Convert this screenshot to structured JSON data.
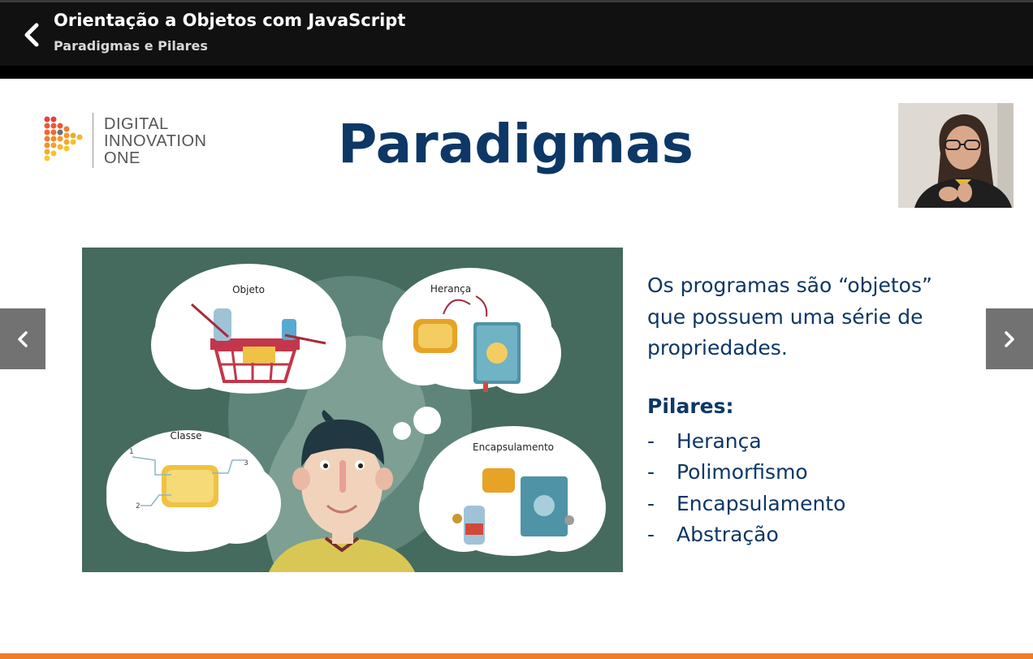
{
  "header": {
    "back_icon": "chevron-left-icon",
    "course_title": "Orientação a Objetos com JavaScript",
    "lesson_title": "Paradigmas e Pilares"
  },
  "slide": {
    "logo": {
      "line1": "DIGITAL",
      "line2": "INNOVATION",
      "line3": "ONE"
    },
    "title": "Paradigmas",
    "illustration_labels": {
      "objeto": "Objeto",
      "heranca": "Herança",
      "classe": "Classe",
      "encapsulamento": "Encapsulamento",
      "n1": "1",
      "n2": "2",
      "n3": "3"
    },
    "body_lines": [
      "Os programas são “objetos”",
      "que possuem uma série de",
      "propriedades."
    ],
    "pillars_title": "Pilares:",
    "pillars": [
      "Herança",
      "Polimorfismo",
      "Encapsulamento",
      "Abstração"
    ],
    "bullet": "-"
  },
  "nav": {
    "prev_icon": "chevron-left-icon",
    "next_icon": "chevron-right-icon"
  },
  "colors": {
    "header_bg": "#111111",
    "title_blue": "#0c3766",
    "illustration_bg": "#456a5e",
    "accent_orange": "#ef7c26",
    "nav_gray": "#727272"
  }
}
